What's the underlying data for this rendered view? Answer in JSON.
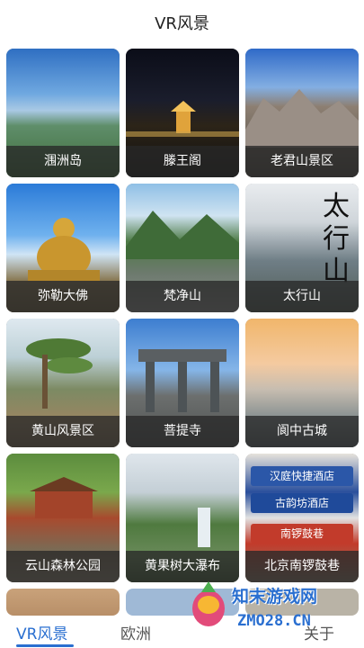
{
  "header": {
    "title": "VR风景"
  },
  "cards": [
    {
      "label": "涠洲岛"
    },
    {
      "label": "滕王阁"
    },
    {
      "label": "老君山景区"
    },
    {
      "label": "弥勒大佛"
    },
    {
      "label": "梵净山"
    },
    {
      "label": "太行山",
      "overlay_text": "太行山"
    },
    {
      "label": "黄山风景区"
    },
    {
      "label": "菩提寺"
    },
    {
      "label": "阆中古城"
    },
    {
      "label": "云山森林公园"
    },
    {
      "label": "黄果树大瀑布"
    },
    {
      "label": "北京南锣鼓巷",
      "signs": [
        "汉庭快捷酒店",
        "古韵坊酒店",
        "南锣鼓巷"
      ]
    }
  ],
  "bottom_tabs": [
    {
      "label": "VR风景",
      "active": true
    },
    {
      "label": "欧洲",
      "active": false
    },
    {
      "label": "关于",
      "active": false
    }
  ],
  "watermark": {
    "line1": "知末游戏网",
    "line2": "ZMO28.CN"
  },
  "colors": {
    "accent": "#2a6fd0",
    "caption_bg": "#282828"
  }
}
